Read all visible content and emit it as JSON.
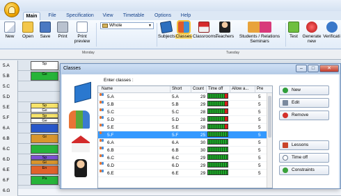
{
  "menu": {
    "tabs": [
      "Main",
      "File",
      "Specification",
      "View",
      "Timetable",
      "Options",
      "Help"
    ]
  },
  "ribbon": {
    "new": "New",
    "open": "Open",
    "save": "Save",
    "print": "Print",
    "print_preview": [
      "Print",
      "preview"
    ],
    "view_select": "Whole",
    "subjects": "Subjects",
    "classes": "Classes",
    "classrooms": "Classrooms",
    "teachers": "Teachers",
    "students": [
      "Students / Relations",
      "Seminars"
    ],
    "test": "Test",
    "generate": [
      "Generate",
      "new"
    ],
    "verification": "Verificati"
  },
  "timetable": {
    "days": [
      "Monday",
      "Tuesday"
    ],
    "rows": [
      "5.A",
      "5.B",
      "5.C",
      "5.D",
      "5.E",
      "5.F",
      "6.A",
      "6.B",
      "6.C",
      "6.D",
      "6.E",
      "6.F",
      "6.G"
    ],
    "cells": [
      "Sp",
      "Ge",
      "Sp",
      "Ge",
      "Sp",
      "Ge",
      "Gi",
      "Sp",
      "Gi",
      "En",
      "Pa"
    ]
  },
  "dialog": {
    "title": "Classes",
    "enter_label": "Enter classes :",
    "columns": [
      "Name",
      "Short",
      "Count",
      "Time off",
      "Allow a...",
      "Pre"
    ],
    "rows": [
      {
        "name": "5.A",
        "short": "5.A",
        "count": "29",
        "pre": "5"
      },
      {
        "name": "5.B",
        "short": "5.B",
        "count": "29",
        "pre": "5"
      },
      {
        "name": "5.C",
        "short": "5.C",
        "count": "28",
        "pre": "5"
      },
      {
        "name": "5.D",
        "short": "5.D",
        "count": "28",
        "pre": "5"
      },
      {
        "name": "5.E",
        "short": "5.E",
        "count": "28",
        "pre": "5"
      },
      {
        "name": "5.F",
        "short": "5.F",
        "count": "25",
        "pre": "5",
        "selected": true
      },
      {
        "name": "6.A",
        "short": "6.A",
        "count": "30",
        "pre": "5"
      },
      {
        "name": "6.B",
        "short": "6.B",
        "count": "30",
        "pre": "5"
      },
      {
        "name": "6.C",
        "short": "6.C",
        "count": "29",
        "pre": "5"
      },
      {
        "name": "6.D",
        "short": "6.D",
        "count": "29",
        "pre": "5"
      },
      {
        "name": "6.E",
        "short": "6.E",
        "count": "29",
        "pre": "5"
      }
    ],
    "buttons": {
      "new": "New",
      "edit": "Edit",
      "remove": "Remove",
      "lessons": "Lessons",
      "time_off": "Time off",
      "constraints": "Constraints"
    }
  }
}
